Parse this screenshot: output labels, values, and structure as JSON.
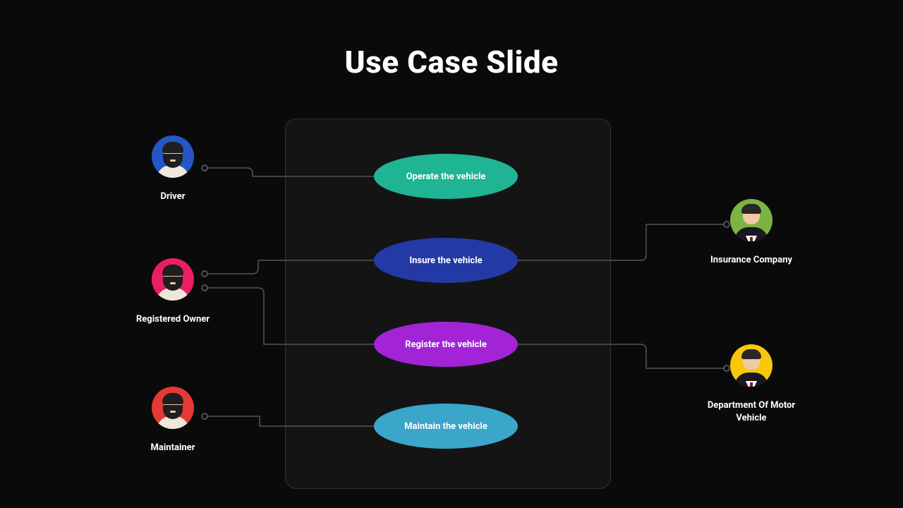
{
  "title": "Use Case Slide",
  "actors": {
    "driver": {
      "label": "Driver",
      "avatar_bg": "#2457c5"
    },
    "owner": {
      "label": "Registered Owner",
      "avatar_bg": "#e91e63"
    },
    "maintainer": {
      "label": "Maintainer",
      "avatar_bg": "#e53935"
    },
    "insurance": {
      "label": "Insurance Company",
      "avatar_bg": "#7cb342"
    },
    "dmv": {
      "label": "Department Of Motor Vehicle",
      "avatar_bg": "#f9c80e"
    }
  },
  "usecases": {
    "operate": {
      "label": "Operate the vehicle",
      "fill": "#1fb493"
    },
    "insure": {
      "label": "Insure the vehicle",
      "fill": "#233aa6"
    },
    "register": {
      "label": "Register the vehicle",
      "fill": "#a224d6"
    },
    "maintain": {
      "label": "Maintain the vehicle",
      "fill": "#3aa6c9"
    }
  },
  "chart_data": {
    "type": "use-case-diagram",
    "title": "Use Case Slide",
    "system_boundary": true,
    "actors": [
      {
        "id": "driver",
        "name": "Driver",
        "side": "left"
      },
      {
        "id": "owner",
        "name": "Registered Owner",
        "side": "left"
      },
      {
        "id": "maintainer",
        "name": "Maintainer",
        "side": "left"
      },
      {
        "id": "insurance",
        "name": "Insurance Company",
        "side": "right"
      },
      {
        "id": "dmv",
        "name": "Department Of Motor Vehicle",
        "side": "right"
      }
    ],
    "use_cases": [
      {
        "id": "operate",
        "name": "Operate the vehicle"
      },
      {
        "id": "insure",
        "name": "Insure the vehicle"
      },
      {
        "id": "register",
        "name": "Register the vehicle"
      },
      {
        "id": "maintain",
        "name": "Maintain the vehicle"
      }
    ],
    "associations": [
      {
        "actor": "driver",
        "use_case": "operate"
      },
      {
        "actor": "owner",
        "use_case": "insure"
      },
      {
        "actor": "owner",
        "use_case": "register"
      },
      {
        "actor": "maintainer",
        "use_case": "maintain"
      },
      {
        "actor": "insurance",
        "use_case": "insure"
      },
      {
        "actor": "dmv",
        "use_case": "register"
      }
    ]
  }
}
